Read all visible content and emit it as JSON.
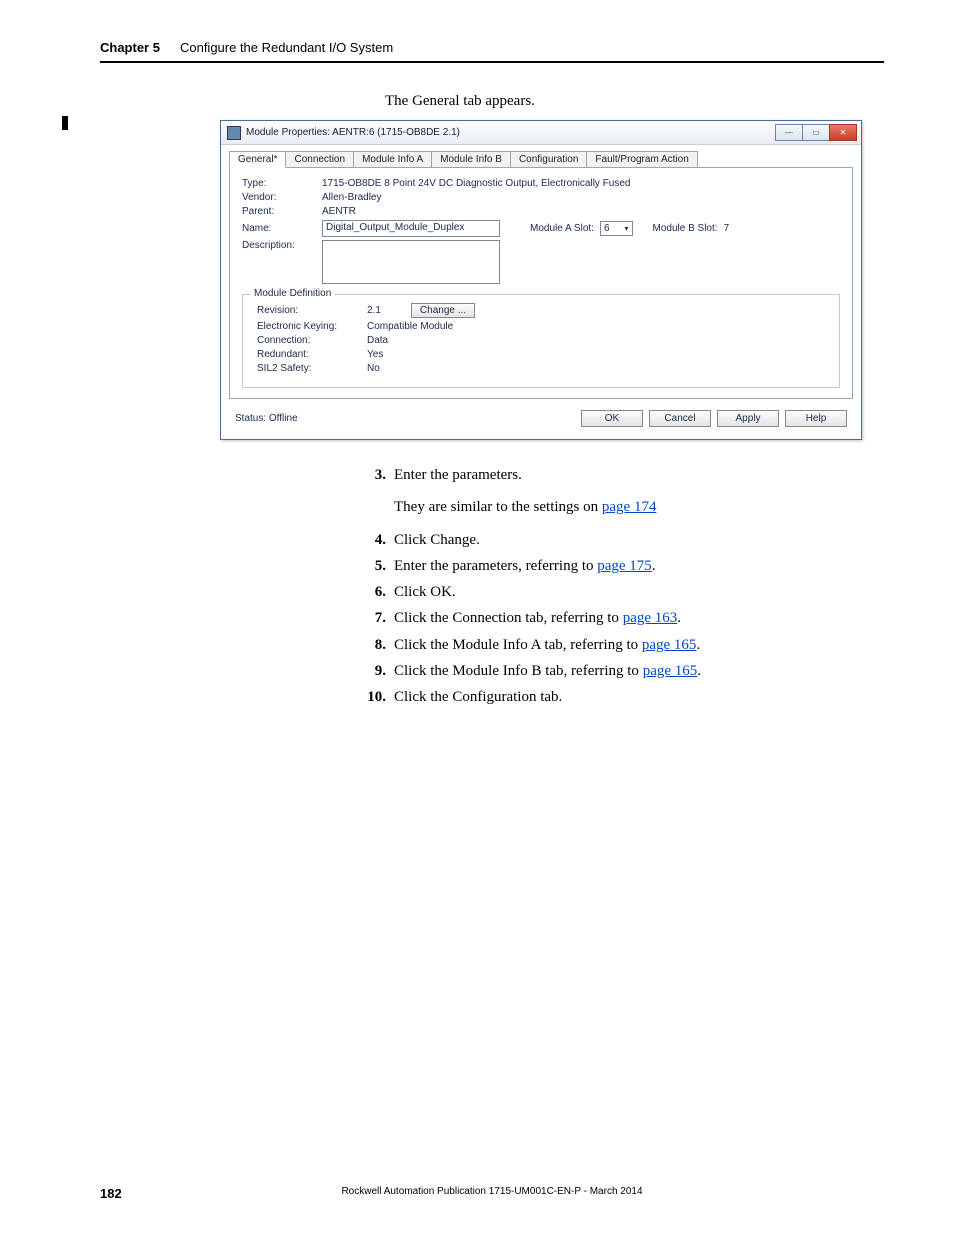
{
  "header": {
    "chapter": "Chapter 5",
    "title": "Configure the Redundant I/O System"
  },
  "caption": "The General tab appears.",
  "dialog": {
    "title": "Module Properties: AENTR:6 (1715-OB8DE 2.1)",
    "tabs": [
      "General*",
      "Connection",
      "Module Info A",
      "Module Info B",
      "Configuration",
      "Fault/Program Action"
    ],
    "type_label": "Type:",
    "type_value": "1715-OB8DE 8 Point 24V DC Diagnostic Output, Electronically Fused",
    "vendor_label": "Vendor:",
    "vendor_value": "Allen-Bradley",
    "parent_label": "Parent:",
    "parent_value": "AENTR",
    "name_label": "Name:",
    "name_value": "Digital_Output_Module_Duplex",
    "slot_a_label": "Module A Slot:",
    "slot_a_value": "6",
    "slot_b_label": "Module B Slot:",
    "slot_b_value": "7",
    "desc_label": "Description:",
    "group_title": "Module Definition",
    "revision_label": "Revision:",
    "revision_value": "2.1",
    "change_btn": "Change ...",
    "keying_label": "Electronic Keying:",
    "keying_value": "Compatible Module",
    "connection_label": "Connection:",
    "connection_value": "Data",
    "redundant_label": "Redundant:",
    "redundant_value": "Yes",
    "sil2_label": "SIL2 Safety:",
    "sil2_value": "No",
    "status_label": "Status: Offline",
    "buttons": {
      "ok": "OK",
      "cancel": "Cancel",
      "apply": "Apply",
      "help": "Help"
    }
  },
  "steps": {
    "s3": "Enter the parameters.",
    "s3_sub_a": "They are similar to the settings on ",
    "s3_sub_link": "page 174",
    "s4": "Click Change.",
    "s5_a": "Enter the parameters, referring to ",
    "s5_link": "page 175",
    "s6": "Click OK.",
    "s7_a": "Click the Connection tab, referring to ",
    "s7_link": "page 163",
    "s8_a": "Click the Module Info A tab, referring to ",
    "s8_link": "page 165",
    "s9_a": "Click the Module Info B tab, referring to ",
    "s9_link": "page 165",
    "s10": "Click the Configuration tab."
  },
  "footer": {
    "page": "182",
    "publication": "Rockwell Automation Publication 1715-UM001C-EN-P - March 2014"
  }
}
